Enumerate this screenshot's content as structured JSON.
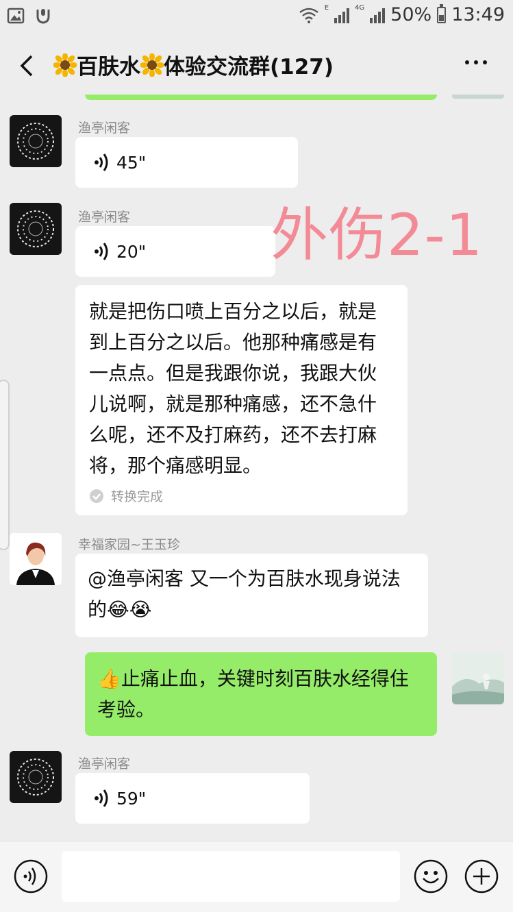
{
  "status_bar": {
    "network_label": "4G",
    "network_sub": "E",
    "battery_pct": "50%",
    "battery_level": 0.5,
    "time": "13:49"
  },
  "header": {
    "title_part1": "百肤水",
    "title_part2": "体验交流群(127)"
  },
  "watermark": "外伤2-1",
  "messages": [
    {
      "type": "voice",
      "sender": "渔亭闲客",
      "duration": "45\""
    },
    {
      "type": "voice",
      "sender": "渔亭闲客",
      "duration": "20\""
    },
    {
      "type": "transcript",
      "text": "就是把伤口喷上百分之以后，就是到上百分之以后。他那种痛感是有一点点。但是我跟你说，我跟大伙儿说啊，就是那种痛感，还不急什么呢，还不及打麻药，还不去打麻将，那个痛感明显。",
      "status": "转换完成"
    },
    {
      "type": "text",
      "sender": "幸福家园~王玉珍",
      "text": "@渔亭闲客  又一个为百肤水现身说法的😂😭"
    },
    {
      "type": "text-self",
      "text": "👍止痛止血，关键时刻百肤水经得住考验。"
    },
    {
      "type": "voice",
      "sender": "渔亭闲客",
      "duration": "59\""
    }
  ],
  "colors": {
    "background": "#ededed",
    "self_bubble": "#95ec69",
    "other_bubble": "#ffffff",
    "watermark": "#f38b96"
  }
}
